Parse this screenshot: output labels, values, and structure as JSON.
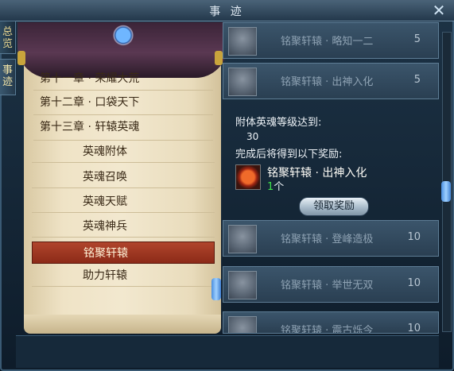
{
  "window": {
    "title": "事 迹",
    "close_glyph": "✕"
  },
  "side_tabs": [
    {
      "label": "总览"
    },
    {
      "label": "事迹"
    }
  ],
  "chapters": [
    {
      "label": "第十一章 · 荣耀大荒"
    },
    {
      "label": "第十二章 · 口袋天下"
    },
    {
      "label": "第十三章 · 轩辕英魂"
    }
  ],
  "sub_items": [
    {
      "label": "英魂附体",
      "selected": false
    },
    {
      "label": "英魂召唤",
      "selected": false
    },
    {
      "label": "英魂天赋",
      "selected": false
    },
    {
      "label": "英魂神兵",
      "selected": false
    },
    {
      "label": "铭聚轩辕",
      "selected": true
    },
    {
      "label": "助力轩辕",
      "selected": false
    }
  ],
  "achievements_top": [
    {
      "name": "铭聚轩辕 · 略知一二",
      "points": "5"
    },
    {
      "name": "铭聚轩辕 · 出神入化",
      "points": "5"
    }
  ],
  "detail": {
    "requirement_label": "附体英魂等级达到:",
    "requirement_value": "30",
    "reward_label": "完成后将得到以下奖励:",
    "reward_name": "铭聚轩辕 ·  出神入化",
    "reward_count": "1",
    "reward_unit": "个",
    "claim_label": "领取奖励"
  },
  "achievements_bottom": [
    {
      "name": "铭聚轩辕 · 登峰造极",
      "points": "10"
    },
    {
      "name": "铭聚轩辕 · 举世无双",
      "points": "10"
    },
    {
      "name": "铭聚轩辕 · 震古烁今",
      "points": "10"
    }
  ],
  "colors": {
    "selected_row": "#a23a22",
    "reward_count": "#3ee24c"
  }
}
